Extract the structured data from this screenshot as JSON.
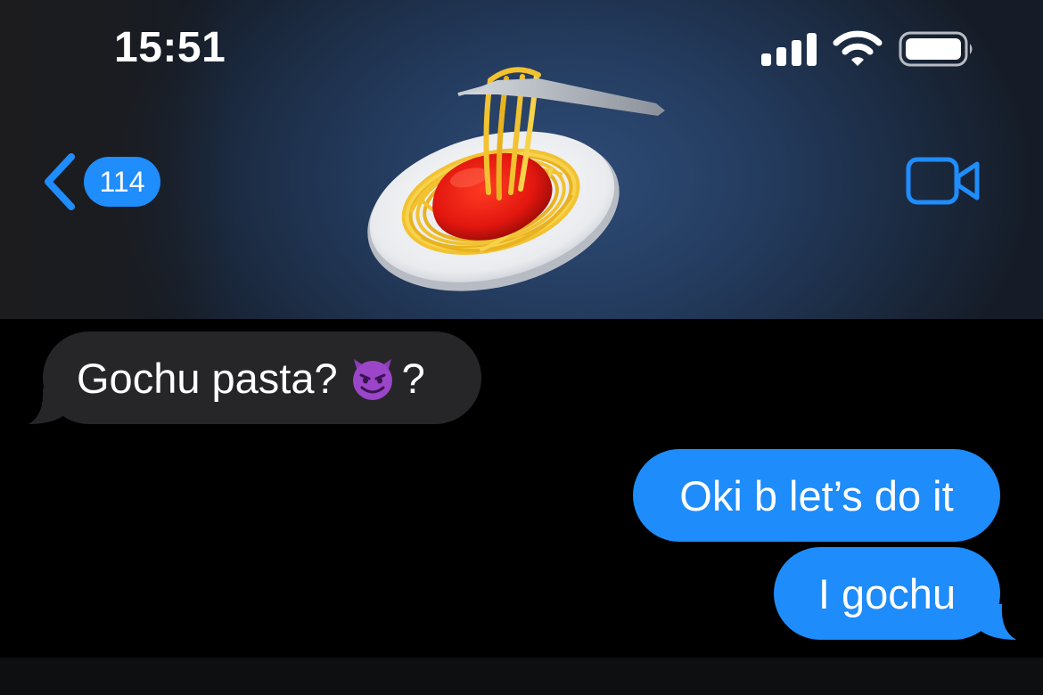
{
  "status_bar": {
    "time": "15:51",
    "signal_icon": "cellular-signal-icon",
    "wifi_icon": "wifi-icon",
    "battery_icon": "battery-icon"
  },
  "nav": {
    "back_icon": "chevron-left-icon",
    "unread_count": "114",
    "video_icon": "video-camera-icon",
    "contact_avatar": "spaghetti-emoji-avatar"
  },
  "messages": [
    {
      "direction": "received",
      "text_before_emoji": "Gochu pasta?",
      "emoji": "smiling-face-with-horns-emoji",
      "text_after_emoji": "?"
    },
    {
      "direction": "sent",
      "text": "Oki b let’s do it"
    },
    {
      "direction": "sent",
      "text": "I gochu"
    }
  ],
  "colors": {
    "accent": "#1e8cfa",
    "received_bubble": "#262629",
    "background": "#000000"
  }
}
